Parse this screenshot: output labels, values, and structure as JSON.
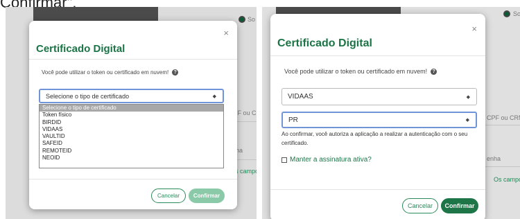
{
  "caption": "Confirmar\".",
  "background": {
    "radio_label": "So",
    "cpf_label": "CPF ou CRM",
    "senha_label": "enha",
    "campos_label": "Os campos"
  },
  "left_modal": {
    "title": "Certificado Digital",
    "close": "×",
    "info_text": "Você pode utilizar o token ou certificado em nuvem!",
    "select_value": "Selecione o tipo de certificado",
    "options": [
      "Selecione o tipo de certificado",
      "Token físico",
      "BIRDID",
      "VIDAAS",
      "VAULTID",
      "SAFEID",
      "REMOTEID",
      "NEOID"
    ],
    "cancel_label": "Cancelar",
    "confirm_label": "Confirmar"
  },
  "right_modal": {
    "title": "Certificado Digital",
    "close": "×",
    "info_text": "Você pode utilizar o token ou certificado em nuvem!",
    "select_type_value": "VIDAAS",
    "select_state_value": "PR",
    "consent_text": "Ao confirmar, você autoriza a aplicação a realizar a autenticação com o seu certificado.",
    "checkbox_label": "Manter a assinatura ativa?",
    "cancel_label": "Cancelar",
    "confirm_label": "Confirmar"
  },
  "colors": {
    "brand_green": "#1d7548",
    "title_green": "#1b7446",
    "disabled_green": "#8bcaa8"
  },
  "icons": {
    "help": "question-circle-icon",
    "close": "close-icon",
    "select_arrow": "updown-arrow-icon"
  }
}
